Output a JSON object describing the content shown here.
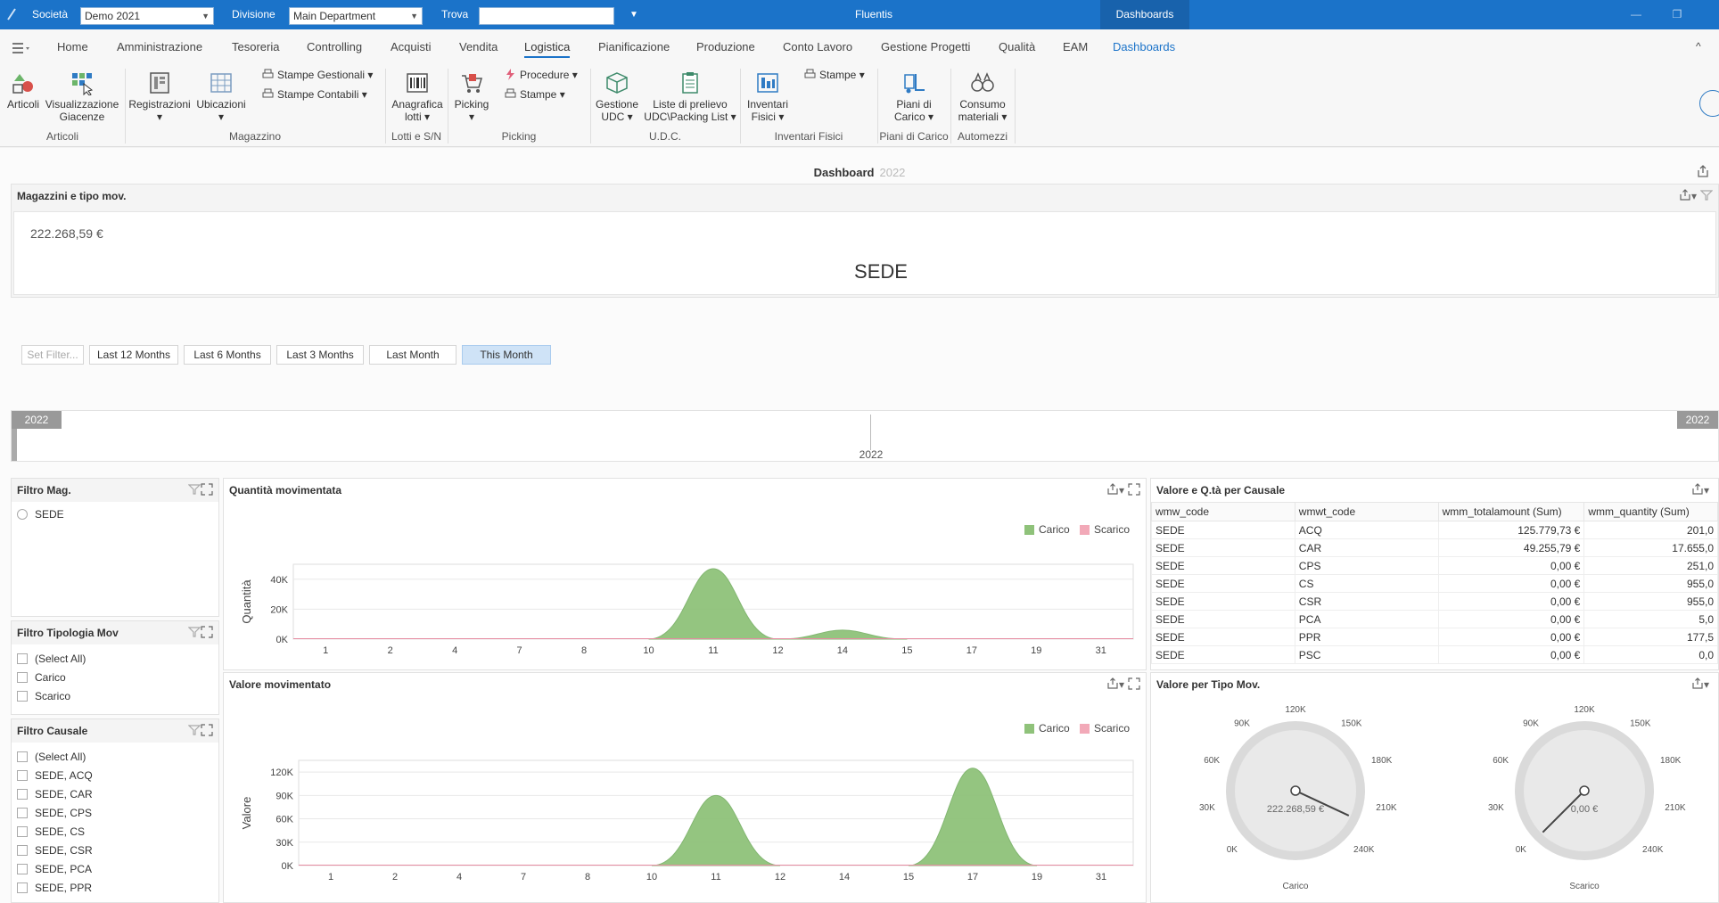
{
  "titlebar": {
    "company_label": "Società",
    "company_value": "Demo 2021",
    "division_label": "Divisione",
    "division_value": "Main Department",
    "search_label": "Trova",
    "search_value": "",
    "app_name": "Fluentis",
    "active_tab": "Dashboards",
    "minimize": "—",
    "restore": "❐",
    "close": "✕"
  },
  "menu": {
    "items": [
      "Home",
      "Amministrazione",
      "Tesoreria",
      "Controlling",
      "Acquisti",
      "Vendita",
      "Logistica",
      "Pianificazione",
      "Produzione",
      "Conto Lavoro",
      "Gestione Progetti",
      "Qualità",
      "EAM",
      "Dashboards"
    ],
    "collapse": "^"
  },
  "ribbon": {
    "articoli": "Articoli",
    "visualizzazione_1": "Visualizzazione",
    "visualizzazione_2": "Giacenze",
    "registrazioni": "Registrazioni",
    "ubicazioni": "Ubicazioni",
    "stampe_gestionali": "Stampe Gestionali",
    "stampe_contabili": "Stampe Contabili",
    "anagrafica_1": "Anagrafica",
    "anagrafica_2": "lotti",
    "picking": "Picking",
    "procedure": "Procedure",
    "stampe": "Stampe",
    "gestione_1": "Gestione",
    "gestione_2": "UDC",
    "liste_1": "Liste di prelievo",
    "liste_2": "UDC\\Packing List",
    "inventari_1": "Inventari",
    "inventari_2": "Fisici",
    "stampe2": "Stampe",
    "piani_1": "Piani di",
    "piani_2": "Carico",
    "consumo_1": "Consumo",
    "consumo_2": "materiali",
    "groups": {
      "articoli": "Articoli",
      "magazzino": "Magazzino",
      "lotti": "Lotti e S/N",
      "picking": "Picking",
      "udc": "U.D.C.",
      "inventari": "Inventari Fisici",
      "piani": "Piani di Carico",
      "automezzi": "Automezzi"
    }
  },
  "dashboard": {
    "title": "Dashboard",
    "year": "2022"
  },
  "kpi": {
    "header": "Magazzini e tipo mov.",
    "value": "222.268,59 €",
    "label": "SEDE"
  },
  "date_filters": [
    "Set Filter...",
    "Last 12 Months",
    "Last 6 Months",
    "Last 3 Months",
    "Last Month",
    "This Month"
  ],
  "range": {
    "left_label": "2022",
    "right_label": "2022",
    "center_label": "2022"
  },
  "filtro_mag": {
    "header": "Filtro Mag.",
    "items": [
      "SEDE"
    ]
  },
  "filtro_tipologia": {
    "header": "Filtro Tipologia Mov",
    "items": [
      "(Select All)",
      "Carico",
      "Scarico"
    ]
  },
  "filtro_causale": {
    "header": "Filtro Causale",
    "items": [
      "(Select All)",
      "SEDE, ACQ",
      "SEDE, CAR",
      "SEDE, CPS",
      "SEDE, CS",
      "SEDE, CSR",
      "SEDE, PCA",
      "SEDE, PPR"
    ]
  },
  "table": {
    "header": "Valore e Q.tà per Causale",
    "columns": [
      "wmw_code",
      "wmwt_code",
      "wmm_totalamount (Sum)",
      "wmm_quantity (Sum)"
    ],
    "rows": [
      [
        "SEDE",
        "ACQ",
        "125.779,73 €",
        "201,0"
      ],
      [
        "SEDE",
        "CAR",
        "49.255,79 €",
        "17.655,0"
      ],
      [
        "SEDE",
        "CPS",
        "0,00 €",
        "251,0"
      ],
      [
        "SEDE",
        "CS",
        "0,00 €",
        "955,0"
      ],
      [
        "SEDE",
        "CSR",
        "0,00 €",
        "955,0"
      ],
      [
        "SEDE",
        "PCA",
        "0,00 €",
        "5,0"
      ],
      [
        "SEDE",
        "PPR",
        "0,00 €",
        "177,5"
      ],
      [
        "SEDE",
        "PSC",
        "0,00 €",
        "0,0"
      ]
    ]
  },
  "gauges": {
    "header": "Valore per Tipo Mov.",
    "ticks": [
      "0K",
      "30K",
      "60K",
      "90K",
      "120K",
      "150K",
      "180K",
      "210K",
      "240K"
    ],
    "carico": {
      "label": "Carico",
      "value": 222268.59,
      "display": "222.268,59 €"
    },
    "scarico": {
      "label": "Scarico",
      "value": 0,
      "display": "0,00 €"
    }
  },
  "colors": {
    "carico": "#8fc27a",
    "scarico": "#f2a9b8",
    "accent": "#1b73c9"
  },
  "chart_data": [
    {
      "type": "area",
      "title": "Quantità movimentata",
      "ylabel": "Quantità",
      "xlabel": "",
      "x": [
        1,
        2,
        4,
        7,
        8,
        10,
        11,
        12,
        14,
        15,
        17,
        19,
        31
      ],
      "ylim": [
        0,
        50000
      ],
      "yticks": [
        "0K",
        "20K",
        "40K"
      ],
      "ytick_values": [
        0,
        20000,
        40000
      ],
      "legend": "top-right",
      "series": [
        {
          "name": "Carico",
          "values": [
            0,
            0,
            0,
            0,
            0,
            0,
            47000,
            0,
            6000,
            0,
            0,
            0,
            0
          ]
        },
        {
          "name": "Scarico",
          "values": [
            0,
            0,
            0,
            0,
            0,
            0,
            0,
            0,
            0,
            0,
            0,
            0,
            0
          ]
        }
      ]
    },
    {
      "type": "area",
      "title": "Valore movimentato",
      "ylabel": "Valore",
      "xlabel": "",
      "x": [
        1,
        2,
        4,
        7,
        8,
        10,
        11,
        12,
        14,
        15,
        17,
        19,
        31
      ],
      "ylim": [
        0,
        135000
      ],
      "yticks": [
        "0K",
        "30K",
        "60K",
        "90K",
        "120K"
      ],
      "ytick_values": [
        0,
        30000,
        60000,
        90000,
        120000
      ],
      "legend": "top-right",
      "series": [
        {
          "name": "Carico",
          "values": [
            0,
            0,
            0,
            0,
            0,
            0,
            90000,
            0,
            0,
            0,
            125000,
            0,
            0
          ]
        },
        {
          "name": "Scarico",
          "values": [
            0,
            0,
            0,
            0,
            0,
            0,
            0,
            0,
            0,
            0,
            0,
            0,
            0
          ]
        }
      ]
    }
  ]
}
